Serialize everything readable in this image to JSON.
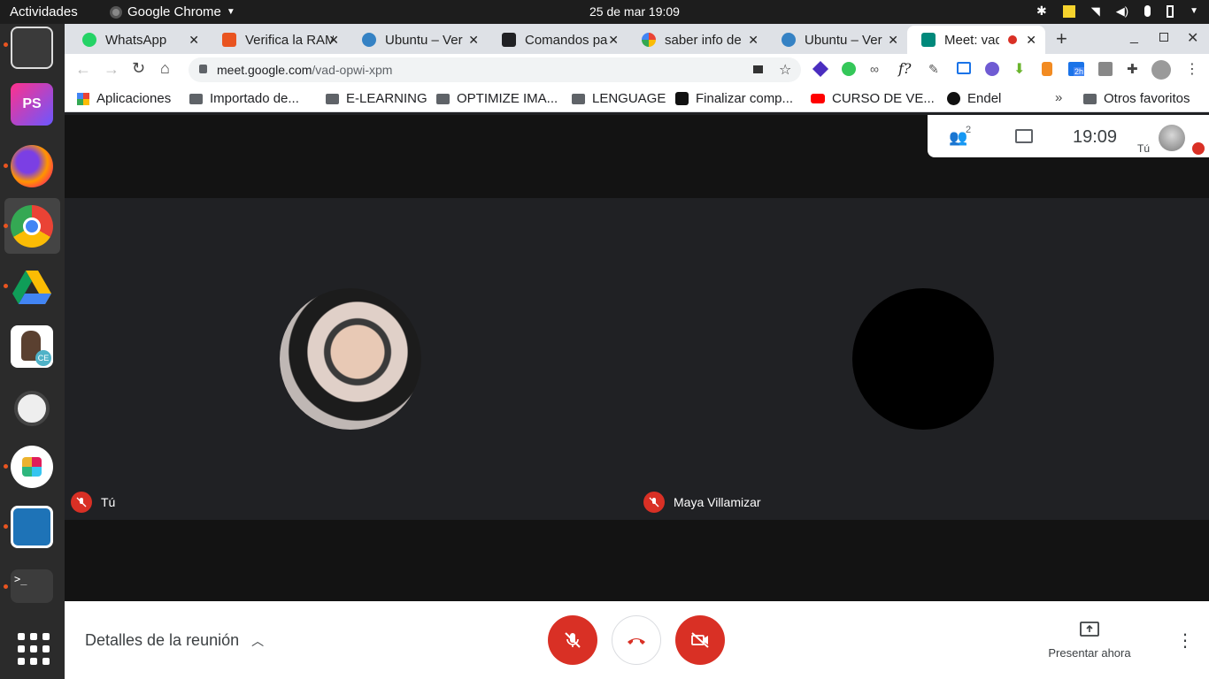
{
  "system": {
    "activities": "Actividades",
    "app_name": "Google Chrome",
    "datetime": "25 de mar  19:09"
  },
  "tabs": [
    {
      "title": "WhatsApp",
      "icon": "whatsapp-icon",
      "color": "#25d366"
    },
    {
      "title": "Verifica la RAM",
      "icon": "ubuntu-icon",
      "color": "#e95420"
    },
    {
      "title": "Ubuntu – Ver",
      "icon": "wordpress-icon",
      "color": "#3582c4"
    },
    {
      "title": "Comandos pa",
      "icon": "terminal-icon",
      "color": "#202124"
    },
    {
      "title": "saber info de",
      "icon": "google-icon",
      "color": "#4285f4"
    },
    {
      "title": "Ubuntu – Ver",
      "icon": "wordpress-icon",
      "color": "#3582c4"
    },
    {
      "title": "Meet: vad",
      "icon": "meet-icon",
      "color": "#00897b"
    }
  ],
  "omnibox": {
    "domain": "meet.google.com",
    "path": "/vad-opwi-xpm"
  },
  "bookmarks": [
    "Aplicaciones",
    "Importado de...",
    "E-LEARNING",
    "OPTIMIZE IMA...",
    "LENGUAGE",
    "Finalizar comp...",
    "CURSO DE VE...",
    "Endel"
  ],
  "other_bookmarks": "Otros favoritos",
  "meet": {
    "participants_count": "2",
    "time": "19:09",
    "self_label": "Tú",
    "tile_self_name": "Tú",
    "tile_other_name": "Maya Villamizar",
    "meeting_details": "Detalles de la reunión",
    "present_now": "Presentar ahora"
  },
  "colors": {
    "red": "#d93025",
    "meet_bg": "#202124",
    "chrome_tab_strip": "#dee1e6"
  },
  "extension_badge": "2h"
}
